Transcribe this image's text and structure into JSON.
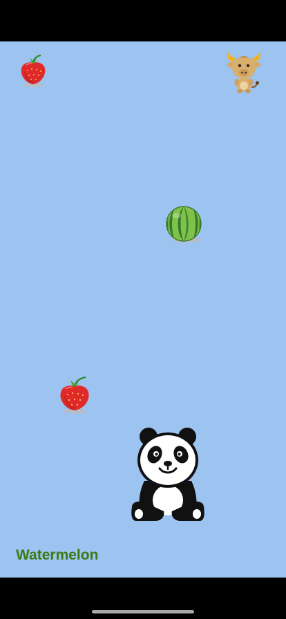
{
  "game": {
    "target_fruit": "Watermelon"
  },
  "sprites": {
    "player": "panda-icon",
    "bonus_character": "ox-icon",
    "falling_items": [
      "strawberry-icon",
      "watermelon-icon",
      "strawberry-icon"
    ]
  },
  "colors": {
    "playfield": "#9DC3F0",
    "label_text": "#3B7A12",
    "bars": "#000000"
  }
}
